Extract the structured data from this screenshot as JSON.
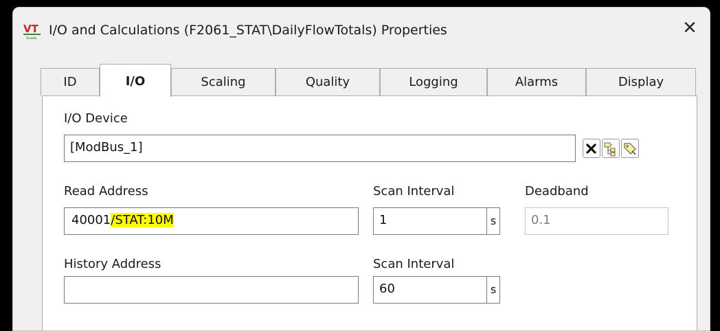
{
  "window": {
    "logo_text": "VT",
    "logo_subtext": "Scada",
    "title": "I/O and Calculations (F2061_STAT\\DailyFlowTotals) Properties",
    "close_glyph": "✕"
  },
  "tabs": [
    {
      "label": "ID",
      "active": false
    },
    {
      "label": "I/O",
      "active": true
    },
    {
      "label": "Scaling",
      "active": false
    },
    {
      "label": "Quality",
      "active": false
    },
    {
      "label": "Logging",
      "active": false
    },
    {
      "label": "Alarms",
      "active": false
    },
    {
      "label": "Display",
      "active": false
    }
  ],
  "io_device": {
    "label": "I/O Device",
    "value": "[ModBus_1]",
    "buttons": [
      {
        "icon": "clear-x-icon"
      },
      {
        "icon": "tag-tree-icon"
      },
      {
        "icon": "tag-browse-icon"
      }
    ]
  },
  "read_address": {
    "label": "Read Address",
    "value_prefix": "40001",
    "value_highlighted": "/STAT:10M"
  },
  "scan_interval_1": {
    "label": "Scan Interval",
    "value": "1",
    "unit": "s"
  },
  "deadband": {
    "label": "Deadband",
    "value": "0.1"
  },
  "history_address": {
    "label": "History Address",
    "value": ""
  },
  "scan_interval_2": {
    "label": "Scan Interval",
    "value": "60",
    "unit": "s"
  },
  "colors": {
    "highlight": "#ffff00",
    "logo_red": "#d42020",
    "logo_green": "#2e8b3a"
  }
}
